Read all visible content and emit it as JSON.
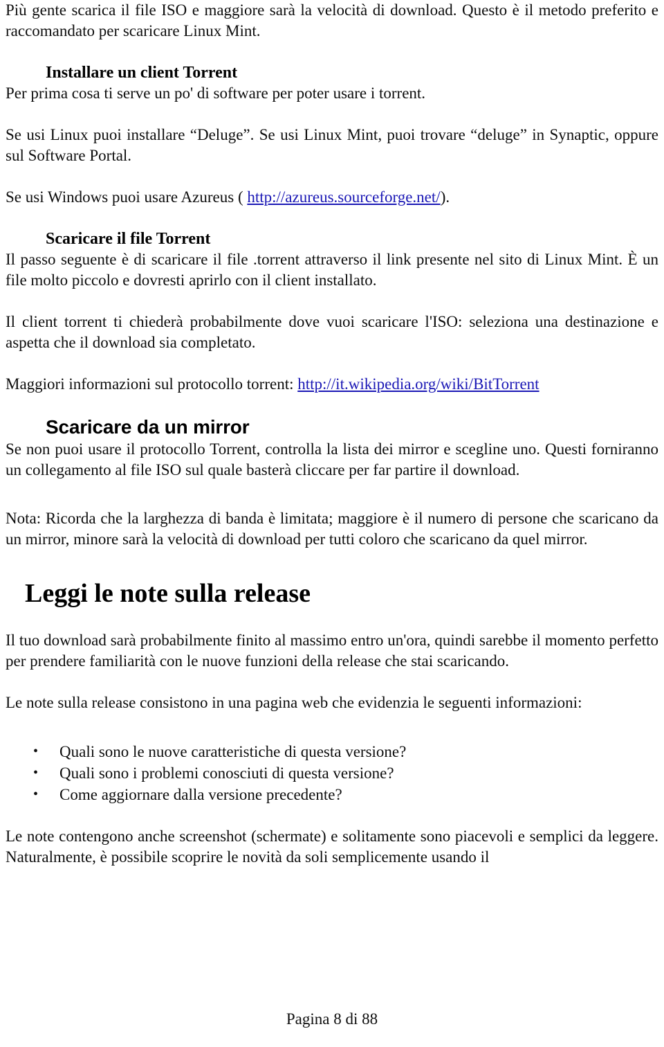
{
  "document": {
    "paragraphs": {
      "intro": "Più gente scarica il file ISO e maggiore sarà la velocità di download. Questo è il metodo preferito e raccomandato per scaricare Linux Mint.",
      "install_intro": "Per prima cosa ti serve un po' di software per poter usare i torrent.",
      "deluge": "Se usi Linux puoi installare “Deluge”. Se usi Linux Mint, puoi trovare “deluge” in Synaptic, oppure sul Software Portal.",
      "windows_prefix": "Se usi Windows puoi usare Azureus ( ",
      "windows_suffix": ").",
      "torrent_step": "Il passo seguente è di scaricare il file .torrent attraverso il link presente nel sito di Linux Mint. È un file molto piccolo e dovresti aprirlo con il client installato.",
      "client_ask": "Il client torrent ti chiederà probabilmente dove vuoi scaricare l'ISO: seleziona una destinazione e aspetta che il download sia completato.",
      "more_info_prefix": "Maggiori informazioni sul protocollo torrent: ",
      "mirror_intro": "Se non puoi usare il protocollo Torrent, controlla la lista dei mirror e scegline uno. Questi forniranno un collegamento al file ISO sul quale basterà cliccare per far partire il download.",
      "note_bandwidth": "Nota: Ricorda che la larghezza di banda è limitata; maggiore è il numero di persone che scaricano da un mirror, minore sarà la velocità di download per tutti coloro che scaricano da quel mirror.",
      "download_time": "Il tuo download sarà probabilmente finito al massimo entro un'ora, quindi sarebbe il momento perfetto per prendere familiarità con le nuove funzioni della release che stai scaricando.",
      "release_notes_intro": "Le note sulla release consistono in una pagina web che evidenzia le seguenti informazioni:",
      "release_notes_outro": "Le note contengono anche screenshot (schermate) e solitamente sono piacevoli e semplici da leggere. Naturalmente, è possibile scoprire le novità da soli semplicemente usando il"
    },
    "headings": {
      "install_client": "Installare un client Torrent",
      "download_torrent": "Scaricare il file Torrent",
      "download_mirror": "Scaricare da un mirror",
      "release_notes": "Leggi le note sulla release"
    },
    "links": {
      "azureus": "http://azureus.sourceforge.net/",
      "bittorrent": "http://it.wikipedia.org/wiki/BitTorrent",
      "color": "#1a17b5"
    },
    "bullets": [
      {
        "marker": "•",
        "text": "Quali sono le nuove caratteristiche di questa versione?"
      },
      {
        "marker": "•",
        "text": "Quali sono i problemi conosciuti di questa versione?"
      },
      {
        "marker": "•",
        "text": "Come aggiornare dalla versione precedente?"
      }
    ],
    "footer": {
      "page_label": "Pagina 8 di 88"
    }
  }
}
